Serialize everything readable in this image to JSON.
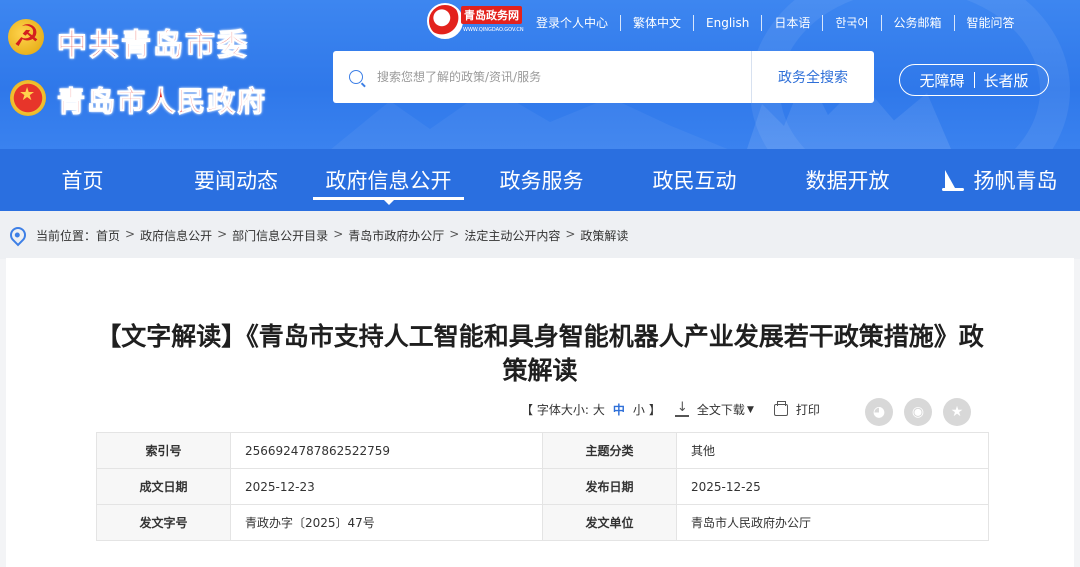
{
  "header": {
    "org_title_1": "中共青岛市委",
    "org_title_2": "青岛市人民政府",
    "portal_logo_text": "青岛政务网",
    "portal_logo_url": "WWW.QINGDAO.GOV.CN",
    "top_links": [
      "登录个人中心",
      "繁体中文",
      "English",
      "日本语",
      "한국어",
      "公务邮箱",
      "智能问答"
    ],
    "search_placeholder": "搜索您想了解的政策/资讯/服务",
    "search_button": "政务全搜索",
    "accessibility": "无障碍",
    "elderly_mode": "长者版",
    "colors": {
      "header_blue": "#3d86f0",
      "nav_blue": "#2a6fe0",
      "title_red": "#e3221c"
    }
  },
  "nav": {
    "items": [
      "首页",
      "要闻动态",
      "政府信息公开",
      "政务服务",
      "政民互动",
      "数据开放",
      "扬帆青岛"
    ],
    "active_index": 2
  },
  "breadcrumb": {
    "label": "当前位置：",
    "items": [
      "首页",
      "政府信息公开",
      "部门信息公开目录",
      "青岛市政府办公厅",
      "法定主动公开内容",
      "政策解读"
    ],
    "separator": ">"
  },
  "article": {
    "title": "【文字解读】《青岛市支持人工智能和具身智能机器人产业发展若干政策措施》政策解读",
    "font_size_label": "【 字体大小: ",
    "font_sizes": [
      "大",
      "中",
      "小"
    ],
    "font_size_close": "】",
    "current_font_size": "中",
    "download_label": "全文下载",
    "print_label": "打印",
    "share_icons": [
      "wechat-icon",
      "weibo-icon",
      "favorite-icon"
    ]
  },
  "meta": {
    "rows": [
      {
        "k1": "索引号",
        "v1": "2566924787862522759",
        "k2": "主题分类",
        "v2": "其他"
      },
      {
        "k1": "成文日期",
        "v1": "2025-12-23",
        "k2": "发布日期",
        "v2": "2025-12-25"
      },
      {
        "k1": "发文字号",
        "v1": "青政办字〔2025〕47号",
        "k2": "发文单位",
        "v2": "青岛市人民政府办公厅"
      }
    ]
  }
}
